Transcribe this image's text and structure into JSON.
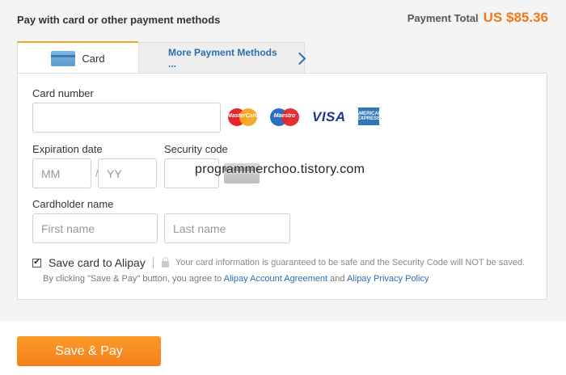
{
  "header": {
    "title": "Pay with card or other payment methods",
    "total_label": "Payment Total",
    "total_amount": "US $85.36"
  },
  "tabs": [
    {
      "label": "Card",
      "active": true
    },
    {
      "label": "More Payment Methods ...",
      "active": false
    }
  ],
  "form": {
    "card_number_label": "Card number",
    "card_number_value": "",
    "expiration_label": "Expiration date",
    "month_placeholder": "MM",
    "year_placeholder": "YY",
    "date_separator": "/",
    "security_label": "Security code",
    "security_value": "",
    "cardholder_label": "Cardholder name",
    "first_name_placeholder": "First name",
    "last_name_placeholder": "Last name"
  },
  "card_brands": {
    "mastercard": "MasterCard",
    "maestro": "Maestro",
    "visa": "VISA",
    "amex": "AMERICAN EXPRESS"
  },
  "save_card": {
    "checked": true,
    "label": "Save card to Alipay",
    "guarantee": "Your card information is guaranteed to be safe and the Security Code will NOT be saved."
  },
  "agreement": {
    "prefix": "By clicking \"Save & Pay\" button, you agree to",
    "link1": "Alipay Account Agreement",
    "middle": "and",
    "link2": "Alipay Privacy Policy"
  },
  "watermark": "programmerchoo.tistory.com",
  "submit": {
    "label": "Save & Pay"
  },
  "colors": {
    "accent": "#f5801b",
    "link": "#2c6fb0",
    "total": "#f07a1a"
  }
}
